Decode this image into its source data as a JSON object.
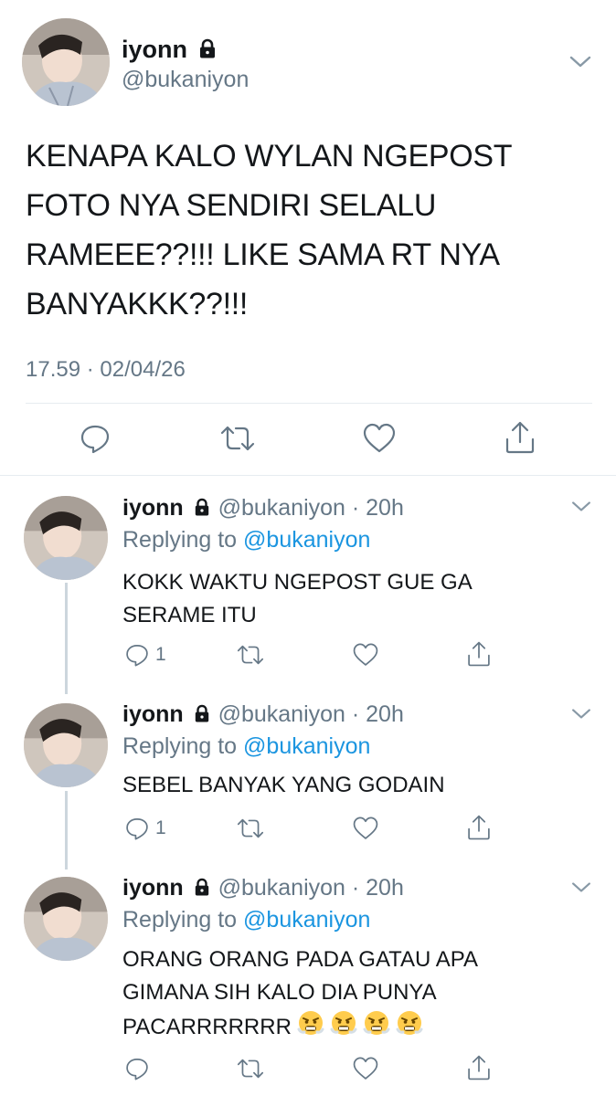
{
  "main_tweet": {
    "name": "iyonn",
    "handle": "@bukaniyon",
    "text_lines": [
      "KENAPA KALO WYLAN NGEPOST",
      "FOTO NYA SENDIRI SELALU",
      "RAMEEE??!!! LIKE SAMA RT NYA",
      "BANYAKKK??!!!"
    ],
    "timestamp": "17.59 · 02/04/26"
  },
  "replies": [
    {
      "name": "iyonn",
      "handle": "@bukaniyon",
      "time": "20h",
      "replying_prefix": "Replying to",
      "replying_handle": "@bukaniyon",
      "text_lines": [
        "KOKK WAKTU NGEPOST GUE GA",
        "SERAME ITU"
      ],
      "reply_count": "1"
    },
    {
      "name": "iyonn",
      "handle": "@bukaniyon",
      "time": "20h",
      "replying_prefix": "Replying to",
      "replying_handle": "@bukaniyon",
      "text_lines": [
        "SEBEL BANYAK YANG GODAIN"
      ],
      "reply_count": "1"
    },
    {
      "name": "iyonn",
      "handle": "@bukaniyon",
      "time": "20h",
      "replying_prefix": "Replying to",
      "replying_handle": "@bukaniyon",
      "text_lines": [
        "ORANG ORANG PADA GATAU APA",
        "GIMANA SIH KALO DIA PUNYA",
        "PACARRRRRRR"
      ],
      "emoji": [
        "😤",
        "😤",
        "😤",
        "😤"
      ],
      "reply_count": ""
    }
  ],
  "colors": {
    "text": "#14171a",
    "muted": "#657786",
    "link": "#1b95e0",
    "divider": "#e6ecf0",
    "thread_line": "#ccd6dd"
  },
  "icons": [
    "lock-icon",
    "chevron-down-icon",
    "reply-icon",
    "retweet-icon",
    "like-icon",
    "share-icon",
    "face-with-steam-emoji"
  ]
}
